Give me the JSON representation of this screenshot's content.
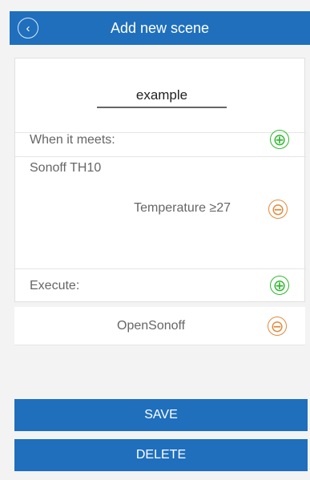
{
  "header": {
    "title": "Add new scene",
    "back_icon": "chevron-left-icon"
  },
  "scene": {
    "name_value": "example"
  },
  "conditions": {
    "label": "When it meets:",
    "device": "Sonoff TH10",
    "items": [
      {
        "text": "Temperature ≥27"
      }
    ]
  },
  "execute": {
    "label": "Execute:",
    "items": [
      {
        "text": "OpenSonoff"
      }
    ]
  },
  "buttons": {
    "save": "SAVE",
    "delete": "DELETE"
  },
  "icons": {
    "add": "⊕",
    "remove": "⊖",
    "back": "‹"
  },
  "colors": {
    "primary": "#1f6fbd",
    "add": "#2eb82e",
    "remove": "#e08a3c"
  }
}
